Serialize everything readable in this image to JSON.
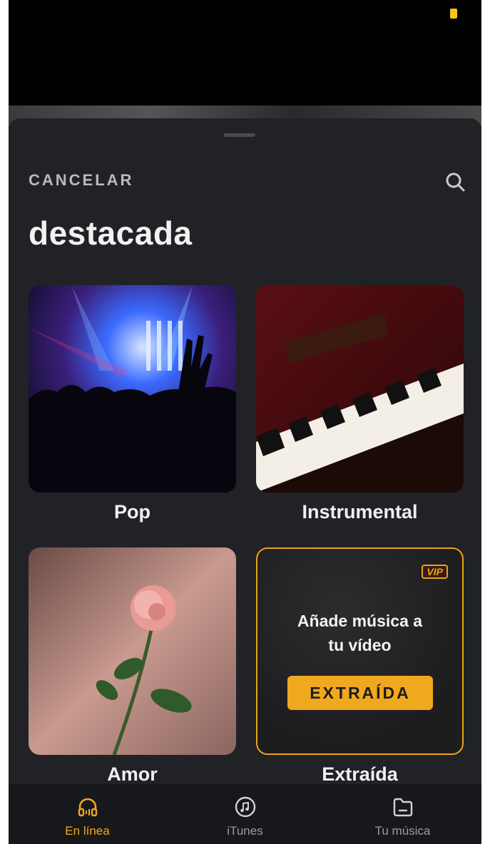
{
  "header": {
    "cancel_label": "CANCELAR",
    "title": "destacada"
  },
  "cards": [
    {
      "label": "Pop",
      "image": "concert-crowd-image"
    },
    {
      "label": "Instrumental",
      "image": "piano-keys-image"
    },
    {
      "label": "Amor",
      "image": "pink-rose-image"
    },
    {
      "label": "Extraída",
      "image": "promo-card"
    }
  ],
  "promo": {
    "badge": "VIP",
    "text_line1": "Añade música a",
    "text_line2": "tu vídeo",
    "button_label": "EXTRAÍDA"
  },
  "tabs": [
    {
      "label": "En línea",
      "icon": "headphones-icon",
      "active": true
    },
    {
      "label": "iTunes",
      "icon": "music-note-icon",
      "active": false
    },
    {
      "label": "Tu música",
      "icon": "folder-icon",
      "active": false
    }
  ],
  "colors": {
    "accent": "#f0a81e",
    "sheet_bg": "#212226",
    "tabbar_bg": "#17181b",
    "inactive_tab": "#9a9ca2"
  }
}
